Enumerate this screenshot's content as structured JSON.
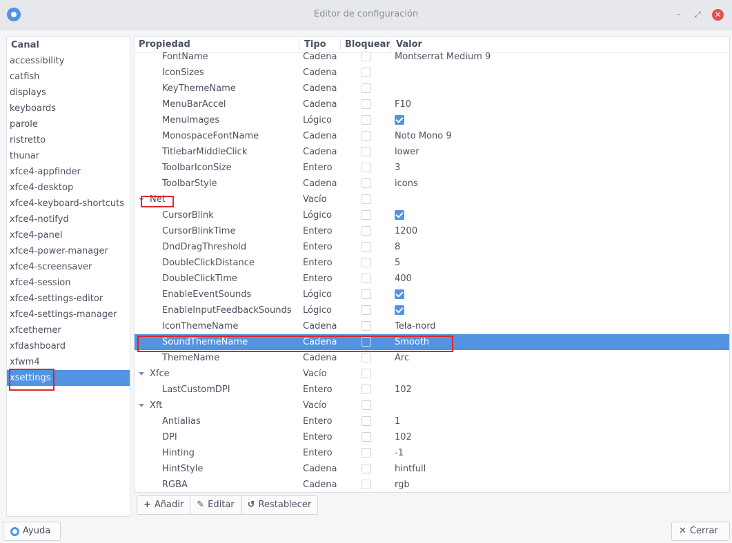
{
  "window": {
    "title": "Editor de configuración",
    "minimize_icon": "–",
    "maximize_icon": "⤢",
    "close_icon": "✕"
  },
  "channels": {
    "header": "Canal",
    "items": [
      "accessibility",
      "catfish",
      "displays",
      "keyboards",
      "parole",
      "ristretto",
      "thunar",
      "xfce4-appfinder",
      "xfce4-desktop",
      "xfce4-keyboard-shortcuts",
      "xfce4-notifyd",
      "xfce4-panel",
      "xfce4-power-manager",
      "xfce4-screensaver",
      "xfce4-session",
      "xfce4-settings-editor",
      "xfce4-settings-manager",
      "xfcethemer",
      "xfdashboard",
      "xfwm4",
      "xsettings"
    ],
    "selected": "xsettings"
  },
  "properties": {
    "headers": {
      "name": "Propiedad",
      "type": "Tipo",
      "lock": "Bloquear",
      "value": "Valor"
    },
    "rows": [
      {
        "name": "FontName",
        "type": "Cadena",
        "value": "Montserrat Medium 9"
      },
      {
        "name": "IconSizes",
        "type": "Cadena",
        "value": ""
      },
      {
        "name": "KeyThemeName",
        "type": "Cadena",
        "value": ""
      },
      {
        "name": "MenuBarAccel",
        "type": "Cadena",
        "value": "F10"
      },
      {
        "name": "MenuImages",
        "type": "Lógico",
        "value": "",
        "checked": true
      },
      {
        "name": "MonospaceFontName",
        "type": "Cadena",
        "value": "Noto Mono 9"
      },
      {
        "name": "TitlebarMiddleClick",
        "type": "Cadena",
        "value": "lower"
      },
      {
        "name": "ToolbarIconSize",
        "type": "Entero",
        "value": "3"
      },
      {
        "name": "ToolbarStyle",
        "type": "Cadena",
        "value": "icons"
      },
      {
        "name": "Net",
        "type": "Vacío",
        "value": "",
        "group": true
      },
      {
        "name": "CursorBlink",
        "type": "Lógico",
        "value": "",
        "checked": true
      },
      {
        "name": "CursorBlinkTime",
        "type": "Entero",
        "value": "1200"
      },
      {
        "name": "DndDragThreshold",
        "type": "Entero",
        "value": "8"
      },
      {
        "name": "DoubleClickDistance",
        "type": "Entero",
        "value": "5"
      },
      {
        "name": "DoubleClickTime",
        "type": "Entero",
        "value": "400"
      },
      {
        "name": "EnableEventSounds",
        "type": "Lógico",
        "value": "",
        "checked": true
      },
      {
        "name": "EnableInputFeedbackSounds",
        "type": "Lógico",
        "value": "",
        "checked": true
      },
      {
        "name": "IconThemeName",
        "type": "Cadena",
        "value": "Tela-nord"
      },
      {
        "name": "SoundThemeName",
        "type": "Cadena",
        "value": "Smooth",
        "selected": true
      },
      {
        "name": "ThemeName",
        "type": "Cadena",
        "value": "Arc"
      },
      {
        "name": "Xfce",
        "type": "Vacío",
        "value": "",
        "group": true
      },
      {
        "name": "LastCustomDPI",
        "type": "Entero",
        "value": "102"
      },
      {
        "name": "Xft",
        "type": "Vacío",
        "value": "",
        "group": true
      },
      {
        "name": "Antialias",
        "type": "Entero",
        "value": "1"
      },
      {
        "name": "DPI",
        "type": "Entero",
        "value": "102"
      },
      {
        "name": "Hinting",
        "type": "Entero",
        "value": "-1"
      },
      {
        "name": "HintStyle",
        "type": "Cadena",
        "value": "hintfull"
      },
      {
        "name": "RGBA",
        "type": "Cadena",
        "value": "rgb"
      }
    ]
  },
  "toolbar": {
    "add_label": "Añadir",
    "add_icon": "+",
    "edit_label": "Editar",
    "edit_icon": "✎",
    "reset_label": "Restablecer",
    "reset_icon": "↺"
  },
  "footer": {
    "help_label": "Ayuda",
    "close_label": "Cerrar",
    "close_icon": "✕"
  },
  "colors": {
    "accent": "#5294e2",
    "highlight_box": "#d9282a"
  }
}
